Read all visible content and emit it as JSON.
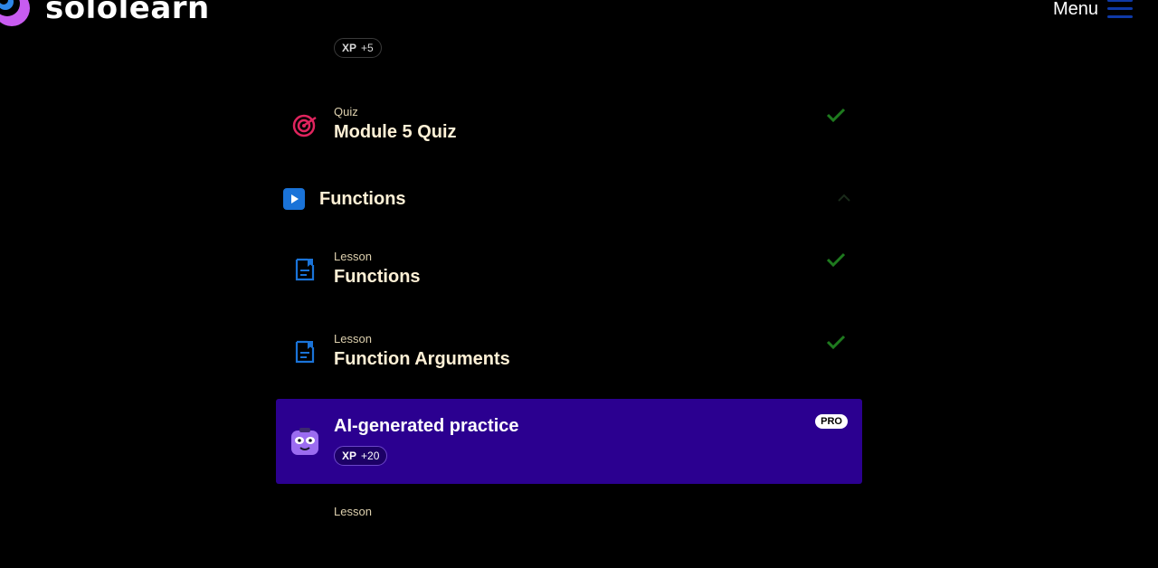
{
  "header": {
    "brand": "sololearn",
    "menu_label": "Menu"
  },
  "top_item": {
    "xp_label": "XP",
    "xp_value": "+5"
  },
  "items": [
    {
      "type": "Quiz",
      "title": "Module 5 Quiz",
      "icon": "target-icon",
      "completed": true
    },
    {
      "type": "Lesson",
      "title": "Functions",
      "icon": "lesson-doc-icon",
      "completed": true
    },
    {
      "type": "Lesson",
      "title": "Function Arguments",
      "icon": "lesson-doc-icon",
      "completed": true
    }
  ],
  "section": {
    "title": "Functions",
    "expanded": true
  },
  "practice": {
    "title": "AI-generated practice",
    "badge": "PRO",
    "xp_label": "XP",
    "xp_value": "+20"
  },
  "bottom_item": {
    "type": "Lesson"
  },
  "colors": {
    "accent_purple": "#2b0090",
    "check_green": "#1e7a1e",
    "quiz_red": "#e0245e",
    "lesson_blue": "#1a73d8"
  }
}
